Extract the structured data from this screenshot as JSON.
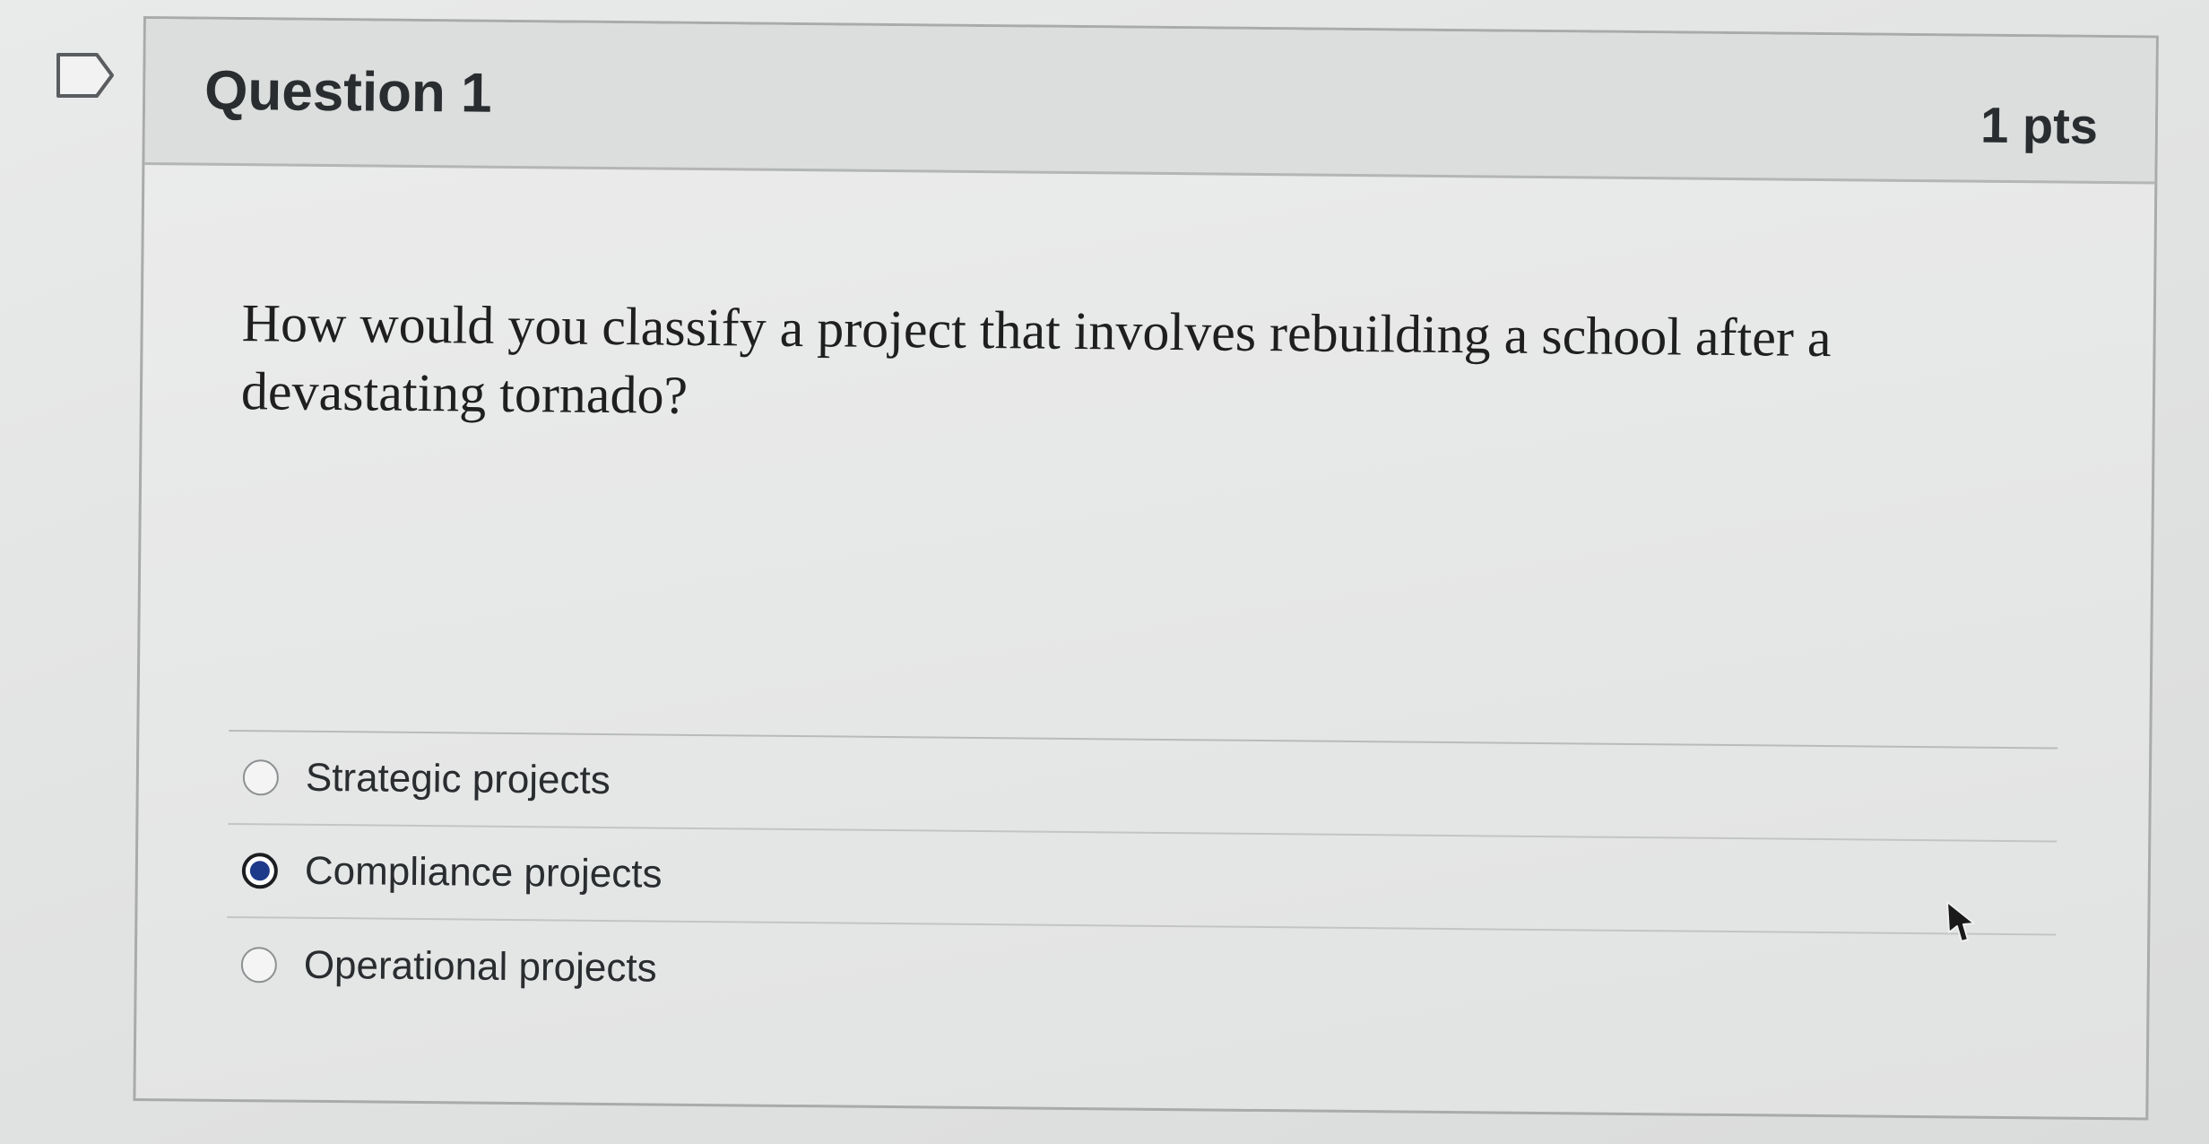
{
  "question": {
    "title": "Question 1",
    "points": "1 pts",
    "text": "How would you classify a project that involves rebuilding a school after a devastating tornado?",
    "flag_icon": "bookmark-flag-icon"
  },
  "answers": [
    {
      "label": "Strategic projects",
      "selected": false
    },
    {
      "label": "Compliance projects",
      "selected": true
    },
    {
      "label": "Operational projects",
      "selected": false
    }
  ],
  "colors": {
    "selected_radio": "#1d3a8a",
    "header_bg": "#dcdddd",
    "text": "#2a2d2f"
  }
}
